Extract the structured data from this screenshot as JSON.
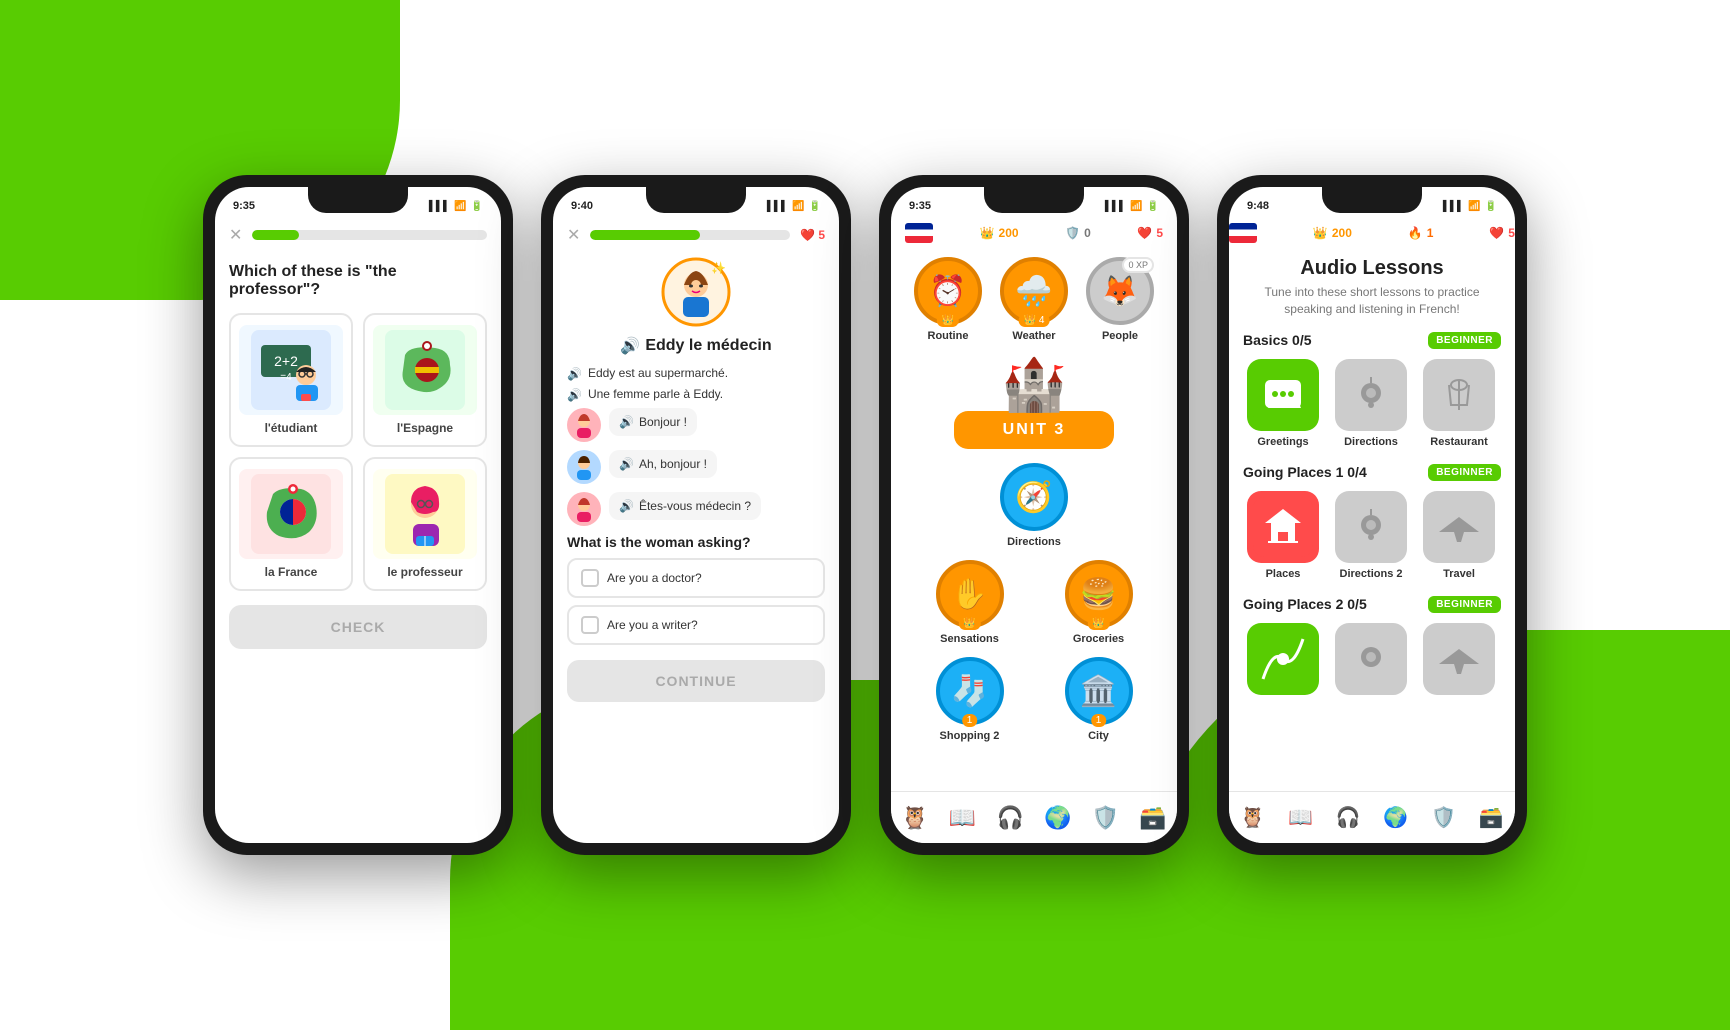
{
  "background": {
    "color": "#ffffff",
    "accent": "#58CC02"
  },
  "phone1": {
    "status_time": "9:35",
    "question": "Which of these is \"the professor\"?",
    "cards": [
      {
        "label": "l'étudiant",
        "emoji": "👨‍🏫",
        "bg": "#dbeafe"
      },
      {
        "label": "l'Espagne",
        "emoji": "📍",
        "bg": "#dcfce7"
      },
      {
        "label": "la France",
        "emoji": "🗺️",
        "bg": "#fee2e2"
      },
      {
        "label": "le professeur",
        "emoji": "👩‍💼",
        "bg": "#fef9c3"
      }
    ],
    "check_button": "CHECK"
  },
  "phone2": {
    "status_time": "9:40",
    "hearts": "5",
    "character_name": "Eddy le médecin",
    "lines": [
      "Eddy est au supermarché.",
      "Une femme parle à Eddy."
    ],
    "dialogues": [
      {
        "text": "Bonjour !",
        "avatar": "👩"
      },
      {
        "text": "Ah, bonjour !",
        "avatar": "👨"
      },
      {
        "text": "Êtes-vous médecin ?",
        "avatar": "👩"
      }
    ],
    "question": "What is the woman asking?",
    "options": [
      "Are you a doctor?",
      "Are you a writer?"
    ],
    "continue_button": "CONTINUE"
  },
  "phone3": {
    "status_time": "9:35",
    "xp": "200",
    "shield": "0",
    "hearts": "5",
    "unit_banner": "UNIT 3",
    "units": [
      {
        "label": "Routine",
        "emoji": "⏰",
        "color": "orange",
        "crown": true
      },
      {
        "label": "Weather",
        "emoji": "🌧️",
        "color": "orange",
        "crown": "4"
      },
      {
        "label": "People",
        "emoji": "🦊",
        "color": "gray",
        "xp": "0 XP"
      },
      {
        "label": "Directions",
        "emoji": "🧭",
        "color": "blue"
      },
      {
        "label": "Sensations",
        "emoji": "✋",
        "color": "orange",
        "crown": true
      },
      {
        "label": "Groceries",
        "emoji": "🍔",
        "color": "orange",
        "crown": true
      },
      {
        "label": "Shopping 2",
        "emoji": "🧦",
        "color": "blue",
        "crown": "1"
      },
      {
        "label": "City",
        "emoji": "🏛️",
        "color": "blue",
        "crown": "1"
      }
    ],
    "nav_icons": [
      "🦉",
      "📖",
      "🎧",
      "🌍",
      "🛡️",
      "🗃️"
    ]
  },
  "phone4": {
    "status_time": "9:48",
    "xp": "200",
    "fire": "1",
    "hearts": "5",
    "page_title": "Audio Lessons",
    "page_subtitle": "Tune into these short lessons to practice speaking and listening in French!",
    "sections": [
      {
        "title": "Basics 0/5",
        "badge": "BEGINNER",
        "lessons": [
          {
            "label": "Greetings",
            "emoji": "💬",
            "color": "green"
          },
          {
            "label": "Directions",
            "emoji": "📍",
            "color": "gray"
          },
          {
            "label": "Restaurant",
            "emoji": "🍽️",
            "color": "gray"
          }
        ]
      },
      {
        "title": "Going Places 1 0/4",
        "badge": "BEGINNER",
        "lessons": [
          {
            "label": "Places",
            "emoji": "🏛️",
            "color": "red"
          },
          {
            "label": "Directions 2",
            "emoji": "📍",
            "color": "gray"
          },
          {
            "label": "Travel",
            "emoji": "✈️",
            "color": "gray"
          }
        ]
      },
      {
        "title": "Going Places 2 0/5",
        "badge": "BEGINNER",
        "lessons": [
          {
            "label": "",
            "emoji": "🌿",
            "color": "green"
          },
          {
            "label": "",
            "emoji": "📍",
            "color": "gray"
          },
          {
            "label": "",
            "emoji": "✈️",
            "color": "gray"
          }
        ]
      }
    ],
    "nav_icons": [
      "🦉",
      "📖",
      "🎧",
      "🌍",
      "🛡️",
      "🗃️"
    ]
  }
}
